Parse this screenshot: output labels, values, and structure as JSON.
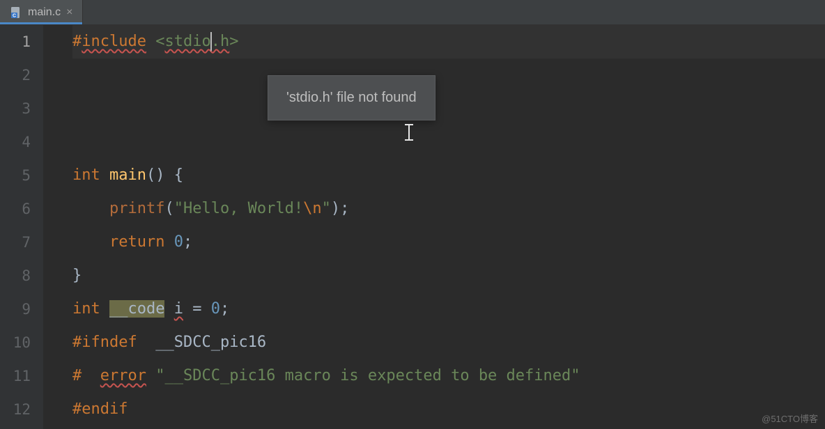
{
  "tab": {
    "filename": "main.c",
    "closeGlyph": "×"
  },
  "lines": [
    "1",
    "2",
    "3",
    "4",
    "5",
    "6",
    "7",
    "8",
    "9",
    "10",
    "11",
    "12"
  ],
  "currentLine": 1,
  "code": {
    "l1": {
      "hash": "#",
      "include": "include",
      "sp": " ",
      "lt": "<",
      "stdio": "stdio",
      "doth": ".h",
      "gt": ">"
    },
    "l5": {
      "kw_int": "int",
      "sp": " ",
      "fn": "main",
      "paren": "()",
      "sp2": " ",
      "brace": "{"
    },
    "l6": {
      "indent": "    ",
      "printf": "printf",
      "lp": "(",
      "q1": "\"",
      "txt": "Hello, World!",
      "esc": "\\n",
      "q2": "\"",
      "rp": ")",
      "semi": ";"
    },
    "l7": {
      "indent": "    ",
      "ret": "return",
      "sp": " ",
      "zero": "0",
      "semi": ";"
    },
    "l8": {
      "brace": "}"
    },
    "l9": {
      "kw_int": "int",
      "sp": " ",
      "code": "__code",
      "sp2": " ",
      "i": "i",
      "sp3": " ",
      "eq": "=",
      "sp4": " ",
      "zero": "0",
      "semi": ";"
    },
    "l10": {
      "hash": "#",
      "ifndef": "ifndef",
      "sp": "  ",
      "mac": "__SDCC_pic16"
    },
    "l11": {
      "hash": "#",
      "sp": "  ",
      "error": "error",
      "sp2": " ",
      "msg": "\"__SDCC_pic16 macro is expected to be defined\""
    },
    "l12": {
      "hash": "#",
      "endif": "endif"
    }
  },
  "tooltip": {
    "text": "'stdio.h' file not found"
  },
  "watermark": "@51CTO博客"
}
